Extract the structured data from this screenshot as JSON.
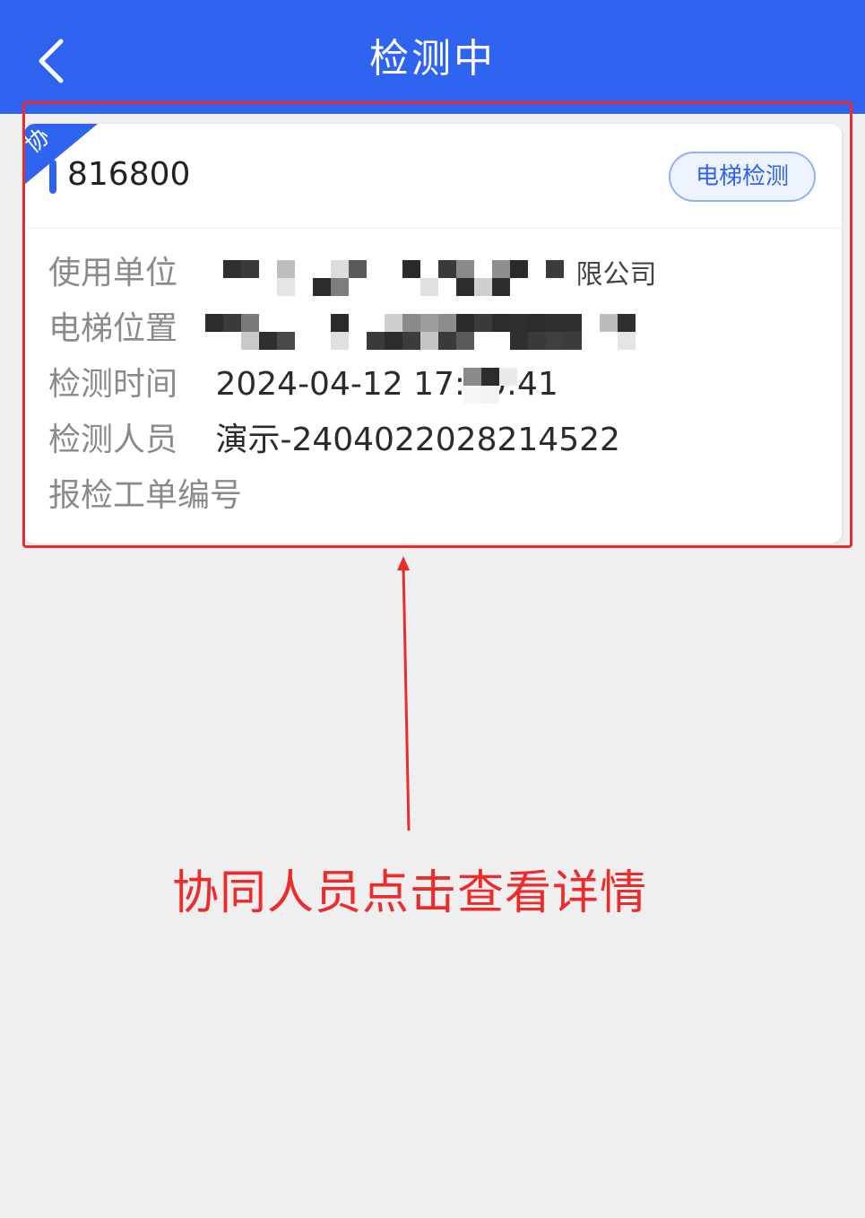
{
  "header": {
    "title": "检测中",
    "back_icon": "chevron-left-icon",
    "background_color": "#2f64f1"
  },
  "task_card": {
    "corner_tag": "协",
    "elevator_id": "816800",
    "type_badge": "电梯检测",
    "fields": [
      {
        "label": "使用单位",
        "value": "限公司",
        "value_partially_redacted": true
      },
      {
        "label": "电梯位置",
        "value": "",
        "value_redacted": true
      },
      {
        "label": "检测时间",
        "value": "2024-04-12 17:50:41",
        "value_partially_redacted": true
      },
      {
        "label": "检测人员",
        "value": "演示-2404022028214522"
      },
      {
        "label": "报检工单编号",
        "value": ""
      }
    ]
  },
  "annotation": {
    "text": "协同人员点击查看详情",
    "color": "#ee2b2b"
  }
}
